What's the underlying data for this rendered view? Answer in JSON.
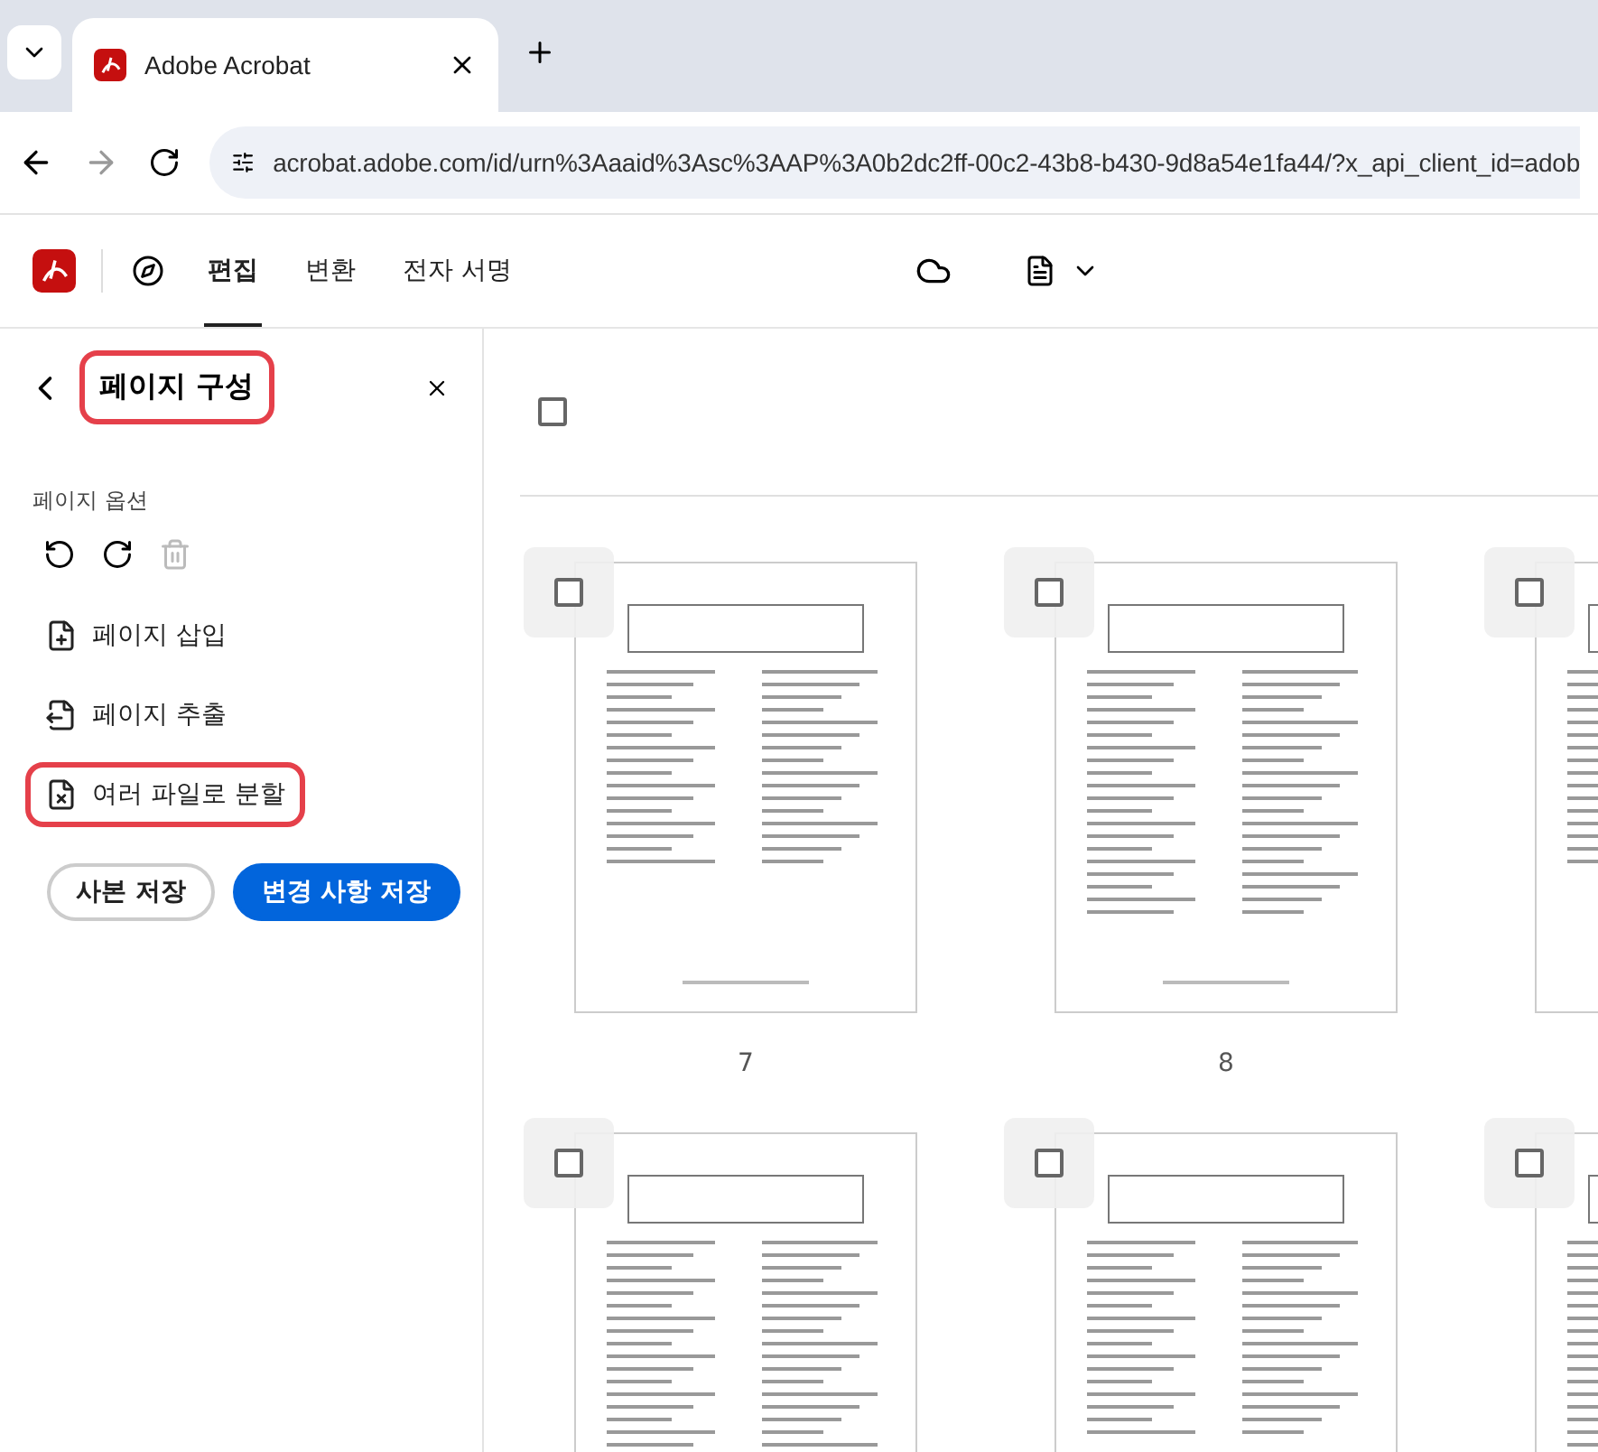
{
  "browser": {
    "tab_title": "Adobe Acrobat",
    "url": "acrobat.adobe.com/id/urn%3Aaaid%3Asc%3AAP%3A0b2dc2ff-00c2-43b8-b430-9d8a54e1fa44/?x_api_client_id=adob"
  },
  "toolbar": {
    "tabs": [
      {
        "label": "편집",
        "selected": true
      },
      {
        "label": "변환",
        "selected": false
      },
      {
        "label": "전자 서명",
        "selected": false
      }
    ]
  },
  "panel": {
    "title": "페이지 구성",
    "title_highlighted": true,
    "section_label": "페이지 옵션",
    "tools": [
      {
        "label": "페이지 삽입",
        "kind": "insert",
        "highlighted": false
      },
      {
        "label": "페이지 추출",
        "kind": "extract",
        "highlighted": false
      },
      {
        "label": "여러 파일로 분할",
        "kind": "split",
        "highlighted": true
      }
    ],
    "buttons": [
      {
        "label": "사본 저장",
        "kind": "secondary"
      },
      {
        "label": "변경 사항 저장",
        "kind": "primary"
      }
    ]
  },
  "select_all": {
    "checked": false
  },
  "pages": [
    {
      "number": "7",
      "checked": false
    },
    {
      "number": "8",
      "checked": false
    },
    {
      "checked": false
    },
    {
      "checked": false
    },
    {
      "checked": false
    },
    {
      "checked": false
    }
  ]
}
